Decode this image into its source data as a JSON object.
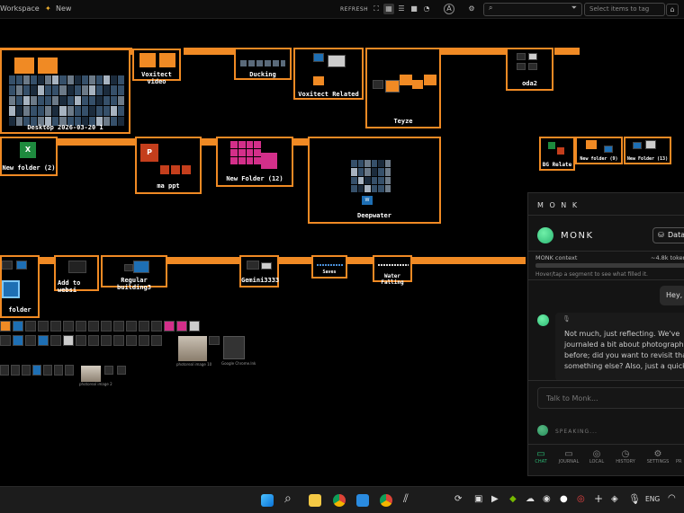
{
  "topbar": {
    "workspace": "Workspace",
    "new_label": "New",
    "refresh": "REFRESH",
    "avatar": "A",
    "tag_placeholder": "Select items to tag"
  },
  "frames": {
    "desktop": "Desktop 2026-03-20 1",
    "voxitect_video": "Voxitect video",
    "ducking": "Ducking",
    "voxitect_related": "Voxitect Related",
    "teyze": "Teyze",
    "oda2": "oda2",
    "new_folder_2": "New folder (2)",
    "ma_ppt": "ma ppt",
    "new_folder_12": "New Folder (12)",
    "deepwater": "Deepwater",
    "bg_relate": "BG Relate",
    "new_folder_9": "New folder (9)",
    "new_folder_13": "New Folder (13)",
    "folder": "folder",
    "add_to_websi": "Add to websi",
    "regular_building3": "Regular building3",
    "gemini3333": "Gemini3333",
    "saves": "Saves",
    "water_falling": "Water Falling"
  },
  "canvas_items": {
    "excel_letter": "X",
    "ppt_letter": "P",
    "doc_letter": "W",
    "photo_caption_1": "photoreal image 10",
    "file_caption": "Google Chrome.lnk",
    "photo_caption_2": "photoreal image 2"
  },
  "monk": {
    "header": "M O N K",
    "name": "MONK",
    "data_button": "Data",
    "context_label": "MONK context",
    "context_tokens": "~4.8k token",
    "hint": "Hover/tap a segment to see what filled it.",
    "user_message": "Hey,",
    "assistant_message": "Not much, just reflecting. We've journaled a bit about photography before; did you want to revisit that something else? Also, just a quick",
    "input_placeholder": "Talk to Monk...",
    "status": "SPEAKING...",
    "tabs": [
      "CHAT",
      "JOURNAL",
      "LOCAL",
      "HISTORY",
      "SETTINGS",
      "PR"
    ]
  },
  "taskbar": {
    "language": "ENG"
  },
  "colors": {
    "accent": "#f08a24",
    "monk_green": "#2bb673",
    "background": "#000000"
  }
}
